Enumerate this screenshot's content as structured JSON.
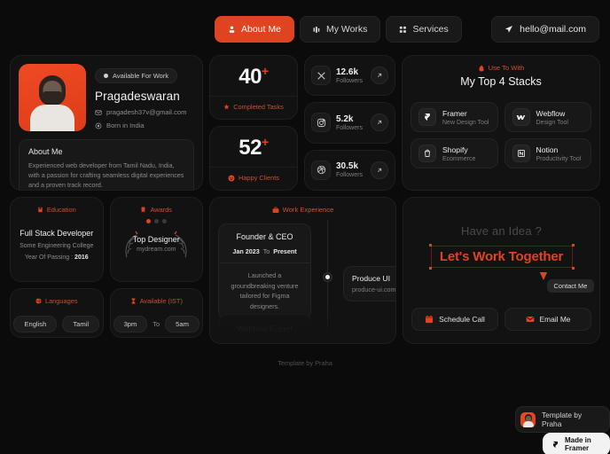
{
  "nav": {
    "items": [
      {
        "label": "About Me",
        "icon": "person-icon",
        "active": true
      },
      {
        "label": "My Works",
        "icon": "bars-icon",
        "active": false
      },
      {
        "label": "Services",
        "icon": "grid-icon",
        "active": false
      }
    ],
    "mail": {
      "label": "hello@mail.com",
      "icon": "send-icon"
    }
  },
  "profile": {
    "availability": "Available For Work",
    "name": "Pragadeswaran",
    "email": "pragadesh37v@gmail.com",
    "location": "Born in India",
    "about_title": "About Me",
    "about_text": "Experienced web developer from Tamil Nadu, India, with a passion for crafting seamless digital experiences and a proven track record."
  },
  "stats": [
    {
      "number": "40",
      "plus": "+",
      "label": "Completed Tasks",
      "icon": "star-icon"
    },
    {
      "number": "52",
      "plus": "+",
      "label": "Happy Clients",
      "icon": "smile-icon"
    }
  ],
  "socials": [
    {
      "icon": "x-icon",
      "count": "12.6k",
      "sub": "Followers",
      "arrow": "arrow-up-right-icon"
    },
    {
      "icon": "instagram-icon",
      "count": "5.2k",
      "sub": "Followers",
      "arrow": "arrow-up-right-icon"
    },
    {
      "icon": "dribbble-icon",
      "count": "30.5k",
      "sub": "Followers",
      "arrow": "arrow-up-right-icon"
    }
  ],
  "stacks": {
    "kicker": "Use To With",
    "kicker_icon": "fire-icon",
    "title": "My Top 4 Stacks",
    "items": [
      {
        "name": "Framer",
        "sub": "New Design Tool",
        "icon": "framer-icon"
      },
      {
        "name": "Webflow",
        "sub": "Design Tool",
        "icon": "webflow-icon"
      },
      {
        "name": "Shopify",
        "sub": "Ecommerce",
        "icon": "shopify-icon"
      },
      {
        "name": "Notion",
        "sub": "Productivity Tool",
        "icon": "notion-icon"
      }
    ]
  },
  "education": {
    "kicker": "Education",
    "kicker_icon": "book-icon",
    "degree": "Full Stack Developer",
    "school": "Some Engineering College",
    "year_label": "Year Of Passing :",
    "year": "2016"
  },
  "awards": {
    "kicker": "Awards",
    "kicker_icon": "medal-icon",
    "title": "Top Designer",
    "source": "mydream.com",
    "dots": 3,
    "active_dot": 0
  },
  "languages": {
    "kicker": "Languages",
    "kicker_icon": "globe-icon",
    "items": [
      "English",
      "Tamil"
    ]
  },
  "available": {
    "kicker": "Available (IST)",
    "kicker_icon": "hourglass-icon",
    "from": "3pm",
    "to_label": "To",
    "to": "5am"
  },
  "work": {
    "kicker": "Work Experience",
    "kicker_icon": "briefcase-icon",
    "role": "Founder & CEO",
    "date_from": "Jan 2023",
    "date_sep": "To",
    "date_to": "Present",
    "description": "Launched a groundbreaking venture tailored for Figma designers.",
    "company": "Produce UI",
    "company_url": "produce-ui.com",
    "ghost_role": "Webflow Expert"
  },
  "cta": {
    "overline": "Have an Idea ?",
    "headline": "Let's Work Together",
    "tooltip": "Contact Me",
    "buttons": [
      {
        "label": "Schedule Call",
        "icon": "calendar-icon"
      },
      {
        "label": "Email Me",
        "icon": "mail-icon"
      }
    ]
  },
  "footer": {
    "credit": "Template by Praha",
    "badge_template": "Template by Praha",
    "badge_framer": "Made in Framer"
  },
  "colors": {
    "accent": "#e0431f",
    "background": "#0b0b0b",
    "card": "#121212",
    "inner": "#181818"
  }
}
